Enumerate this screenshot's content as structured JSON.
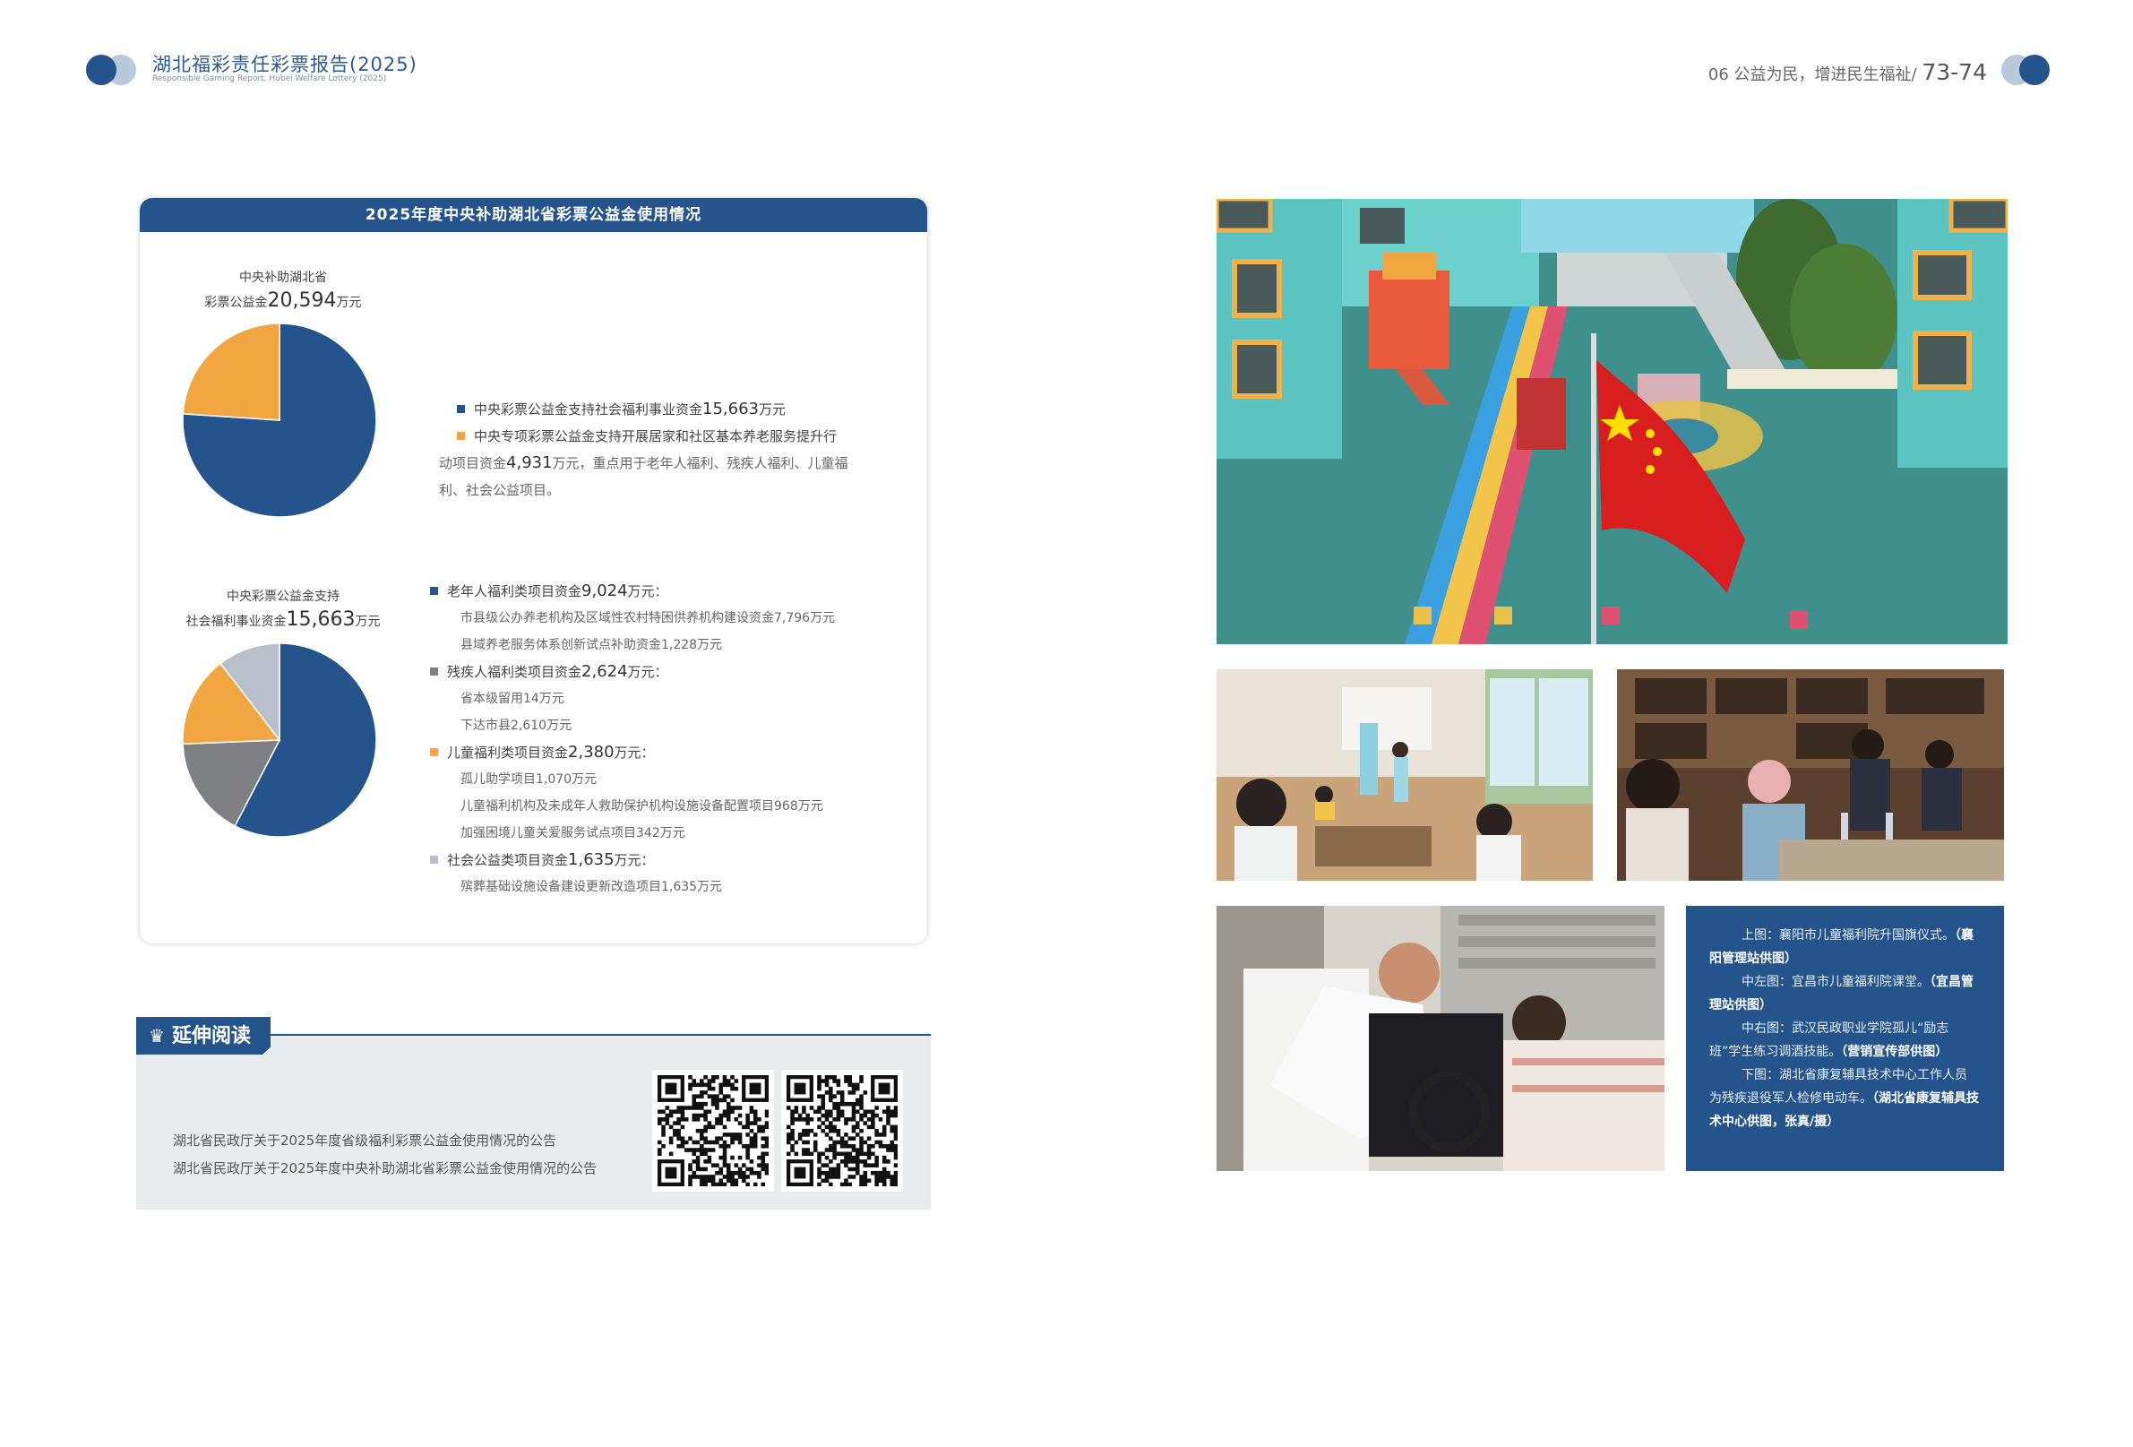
{
  "header": {
    "left_title": "湖北福彩责任彩票报告(2025)",
    "left_subtitle": "Responsible Gaming Report, Hubei Welfare Lottery (2025)",
    "section": "06 公益为民，增进民生福祉/",
    "pages": "73-74"
  },
  "card": {
    "title": "2025年度中央补助湖北省彩票公益金使用情况"
  },
  "pie1": {
    "caption_line1": "中央补助湖北省",
    "caption_pre": "彩票公益金",
    "caption_num": "20,594",
    "caption_unit": "万元"
  },
  "legend1": [
    {
      "color": "#25548c",
      "pre": "中央彩票公益金支持社会福利事业资金",
      "num": "15,663",
      "post": "万元"
    },
    {
      "color": "#f2a641",
      "pre": "中央专项彩票公益金支持开展居家和社区基本养老服务提升行",
      "cont1_pre": "动项目资金",
      "cont1_num": "4,931",
      "cont1_post": "万元，重点用于老年人福利、残疾人福利、儿童福",
      "cont2": "利、社会公益项目。"
    }
  ],
  "pie2": {
    "caption_line1": "中央彩票公益金支持",
    "caption_pre": "社会福利事业资金",
    "caption_num": "15,663",
    "caption_unit": "万元"
  },
  "legend2": [
    {
      "color": "#25548c",
      "pre": "老年人福利类项目资金",
      "num": "9,024",
      "post": "万元：",
      "subs": [
        "市县级公办养老机构及区域性农村特困供养机构建设资金7,796万元",
        "县域养老服务体系创新试点补助资金1,228万元"
      ]
    },
    {
      "color": "#7f8084",
      "pre": "残疾人福利类项目资金",
      "num": "2,624",
      "post": "万元：",
      "subs": [
        "省本级留用14万元",
        "下达市县2,610万元"
      ]
    },
    {
      "color": "#f2a641",
      "pre": "儿童福利类项目资金",
      "num": "2,380",
      "post": "万元：",
      "subs": [
        "孤儿助学项目1,070万元",
        "儿童福利机构及未成年人救助保护机构设施设备配置项目968万元",
        "加强困境儿童关爱服务试点项目342万元"
      ]
    },
    {
      "color": "#b8c0cc",
      "pre": "社会公益类项目资金",
      "num": "1,635",
      "post": "万元：",
      "subs": [
        "殡葬基础设施设备建设更新改造项目1,635万元"
      ]
    }
  ],
  "chart_data": [
    {
      "type": "pie",
      "title": "中央补助湖北省彩票公益金20,594万元",
      "labels": [
        "中央彩票公益金支持社会福利事业资金",
        "中央专项彩票公益金支持开展居家和社区基本养老服务提升行动项目资金"
      ],
      "values": [
        15663,
        4931
      ],
      "colors": [
        "#25548c",
        "#f2a641"
      ]
    },
    {
      "type": "pie",
      "title": "中央彩票公益金支持社会福利事业资金15,663万元",
      "labels": [
        "老年人福利类项目资金",
        "残疾人福利类项目资金",
        "儿童福利类项目资金",
        "社会公益类项目资金"
      ],
      "values": [
        9024,
        2624,
        2380,
        1635
      ],
      "colors": [
        "#25548c",
        "#7f8084",
        "#f2a641",
        "#b8c0cc"
      ]
    }
  ],
  "extended": {
    "tag": "延伸阅读",
    "line1": "湖北省民政厅关于2025年度省级福利彩票公益金使用情况的公告",
    "line2": "湖北省民政厅关于2025年度中央补助湖北省彩票公益金使用情况的公告"
  },
  "captions": [
    {
      "text": "上图：襄阳市儿童福利院升国旗仪式。",
      "src": "（襄阳管理站供图）"
    },
    {
      "text": "中左图：宜昌市儿童福利院课堂。",
      "src": "（宜昌管理站供图）"
    },
    {
      "text": "中右图：武汉民政职业学院孤儿“励志班”学生练习调酒技能。",
      "src": "（营销宣传部供图）"
    },
    {
      "text": "下图：湖北省康复辅具技术中心工作人员为残疾退役军人检修电动车。",
      "src": "（湖北省康复辅具技术中心供图，张真/摄）"
    }
  ]
}
